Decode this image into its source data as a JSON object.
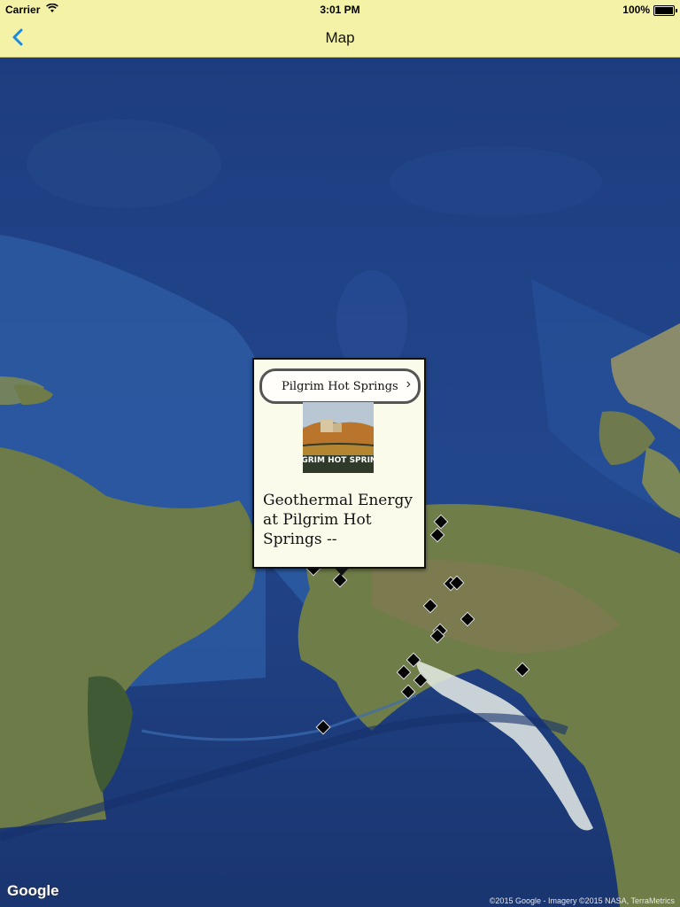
{
  "status": {
    "carrier": "Carrier",
    "time": "3:01 PM",
    "battery": "100%"
  },
  "nav": {
    "title": "Map",
    "back_icon": "chevron-left-icon",
    "accent": "#1a8ae3"
  },
  "callout": {
    "title": "Pilgrim Hot Springs",
    "description": "Geothermal Energy at Pilgrim Hot Springs --",
    "image_caption": "PILGRIM HOT SPRINGS"
  },
  "map": {
    "branding": "Google",
    "attribution": "©2015 Google - Imagery ©2015 NASA, TerraMetrics",
    "colors": {
      "ocean_deep": "#1c3a78",
      "ocean_shelf": "#2f62a8",
      "land": "#6f7f4a",
      "snow": "#e8efe8"
    }
  },
  "toolbar_bg": "#f4f2a6"
}
